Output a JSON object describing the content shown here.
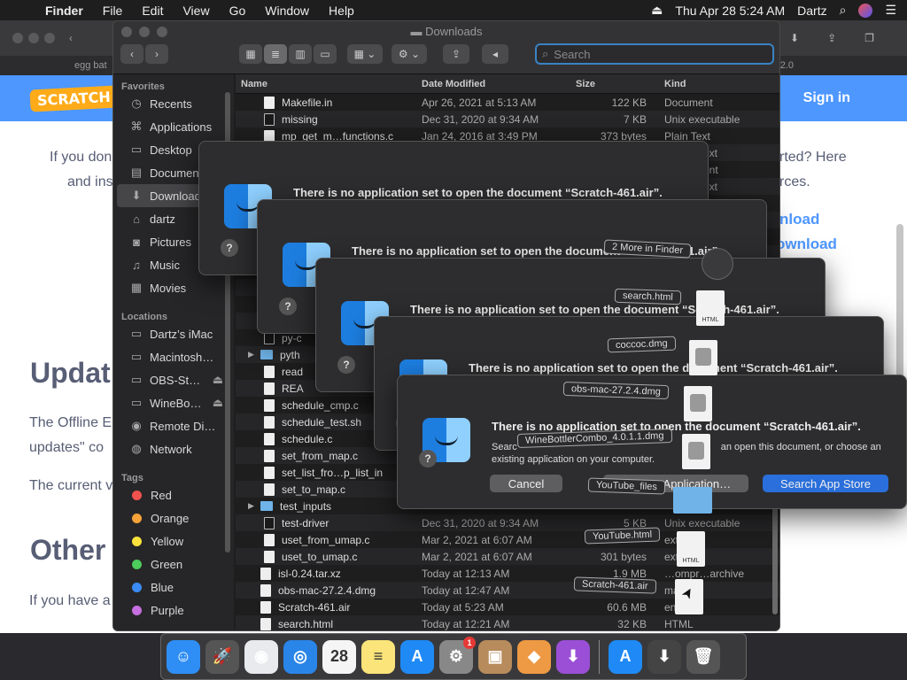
{
  "menubar": {
    "apple": "",
    "app": "Finder",
    "items": [
      "File",
      "Edit",
      "View",
      "Go",
      "Window",
      "Help"
    ],
    "clock": "Thu Apr 28  5:24 AM",
    "user": "Dartz"
  },
  "browser": {
    "tab_fragment": "egg bat",
    "tab_right_fragment": "2.0",
    "logo": "SCRATCH",
    "sign_in": "Sign in",
    "para1_left": "If you don",
    "para1_right": "rted? Here",
    "para2_left": "and ins",
    "para2_right": "rces.",
    "link1": "nload",
    "link2": "ownload",
    "h_update": "Updat",
    "offline_left": "The Offline E",
    "offline2": "updates\" co",
    "current": "The current v",
    "h_other": "Other",
    "ifyou": "If you have a"
  },
  "finder": {
    "title": "Downloads",
    "search_placeholder": "Search",
    "sidebar": {
      "favorites_header": "Favorites",
      "favorites": [
        {
          "label": "Recents",
          "icon": "clock-icon",
          "glyph": "◷"
        },
        {
          "label": "Applications",
          "icon": "applications-icon",
          "glyph": "⌘"
        },
        {
          "label": "Desktop",
          "icon": "desktop-icon",
          "glyph": "▭"
        },
        {
          "label": "Documents",
          "icon": "documents-icon",
          "glyph": "▤"
        },
        {
          "label": "Downloads",
          "icon": "downloads-icon",
          "glyph": "⬇"
        },
        {
          "label": "dartz",
          "icon": "home-icon",
          "glyph": "⌂"
        },
        {
          "label": "Pictures",
          "icon": "camera-icon",
          "glyph": "◙"
        },
        {
          "label": "Music",
          "icon": "music-icon",
          "glyph": "♫"
        },
        {
          "label": "Movies",
          "icon": "movies-icon",
          "glyph": "▦"
        }
      ],
      "locations_header": "Locations",
      "locations": [
        {
          "label": "Dartz’s iMac",
          "icon": "imac-icon",
          "glyph": "▭"
        },
        {
          "label": "Macintosh…",
          "icon": "disk-icon",
          "glyph": "▭"
        },
        {
          "label": "OBS-St…",
          "icon": "disk-icon",
          "glyph": "▭"
        },
        {
          "label": "WineBo…",
          "icon": "disk-icon",
          "glyph": "▭"
        },
        {
          "label": "Remote Di…",
          "icon": "remote-disc-icon",
          "glyph": "◉"
        },
        {
          "label": "Network",
          "icon": "network-icon",
          "glyph": "◍"
        }
      ],
      "tags_header": "Tags",
      "tags": [
        {
          "label": "Red",
          "color": "#f0524f"
        },
        {
          "label": "Orange",
          "color": "#f6a338"
        },
        {
          "label": "Yellow",
          "color": "#f9e23c"
        },
        {
          "label": "Green",
          "color": "#4ccd5c"
        },
        {
          "label": "Blue",
          "color": "#3b8af6"
        },
        {
          "label": "Purple",
          "color": "#c66fe0"
        }
      ]
    },
    "columns": {
      "name": "Name",
      "date": "Date Modified",
      "size": "Size",
      "kind": "Kind"
    },
    "rows_top": [
      {
        "name": "Makefile.in",
        "date": "Apr 26, 2021 at 5:13 AM",
        "size": "122 KB",
        "kind": "Document",
        "type": "doc"
      },
      {
        "name": "missing",
        "date": "Dec 31, 2020 at 9:34 AM",
        "size": "7 KB",
        "kind": "Unix executable",
        "type": "exec"
      },
      {
        "name": "mp_get_m…functions.c",
        "date": "Jan 24, 2016 at 3:49 PM",
        "size": "373 bytes",
        "kind": "Plain Text",
        "type": "doc"
      }
    ],
    "peek_kinds": [
      "ext",
      "ent",
      "ext"
    ],
    "rows_mid": [
      {
        "name": "py-c",
        "indent": 1,
        "type": "exec"
      },
      {
        "name": "pyth",
        "indent": 0,
        "type": "folder",
        "tri": "▶"
      },
      {
        "name": "read",
        "indent": 1,
        "type": "doc"
      },
      {
        "name": "REA",
        "indent": 1,
        "type": "doc"
      },
      {
        "name": "schedule_cmp.c",
        "indent": 1,
        "type": "doc"
      },
      {
        "name": "schedule_test.sh",
        "indent": 1,
        "type": "doc"
      },
      {
        "name": "schedule.c",
        "indent": 1,
        "type": "doc"
      },
      {
        "name": "set_from_map.c",
        "indent": 1,
        "type": "doc"
      },
      {
        "name": "set_list_fro…p_list_in",
        "indent": 1,
        "type": "doc"
      },
      {
        "name": "set_to_map.c",
        "indent": 1,
        "type": "doc"
      },
      {
        "name": "test_inputs",
        "indent": 0,
        "type": "folder",
        "tri": "▶"
      }
    ],
    "rows_bottom": [
      {
        "name": "test-driver",
        "date": "Dec 31, 2020 at 9:34 AM",
        "size": "5 KB",
        "kind": "Unix executable",
        "type": "exec",
        "indent": 1
      },
      {
        "name": "uset_from_umap.c",
        "date": "Mar 2, 2021 at 6:07 AM",
        "size": "",
        "kind": "ext",
        "type": "doc",
        "indent": 1
      },
      {
        "name": "uset_to_umap.c",
        "date": "Mar 2, 2021 at 6:07 AM",
        "size": "301 bytes",
        "kind": "ext",
        "type": "doc",
        "indent": 1
      },
      {
        "name": "isl-0.24.tar.xz",
        "date": "Today at 12:13 AM",
        "size": "1.9 MB",
        "kind": "…ompr…archive",
        "type": "doc",
        "indent": 0
      },
      {
        "name": "obs-mac-27.2.4.dmg",
        "date": "Today at 12:47 AM",
        "size": "",
        "kind": "mage",
        "type": "doc",
        "indent": 0
      },
      {
        "name": "Scratch-461.air",
        "date": "Today at 5:23 AM",
        "size": "60.6 MB",
        "kind": "ent",
        "type": "doc",
        "indent": 0
      },
      {
        "name": "search.html",
        "date": "Today at 12:21 AM",
        "size": "32 KB",
        "kind": "HTML",
        "type": "doc",
        "indent": 0
      }
    ]
  },
  "dialog": {
    "message": "There is no application set to open the document “Scratch-461.air”.",
    "sub_line1": "Searc",
    "sub_line1_right": "an open this document, or choose an",
    "sub_line2": "existing application on your computer.",
    "help": "?",
    "cancel": "Cancel",
    "choose": "Choose Application…",
    "store": "Search App Store"
  },
  "drag": {
    "more": "2 More in Finder",
    "files": [
      "search.html",
      "coccoc.dmg",
      "obs-mac-27.2.4.dmg",
      "WineBottlerCombo_4.0.1.1.dmg",
      "YouTube_files",
      "YouTube.html",
      "Scratch-461.air"
    ],
    "html_tag": "HTML"
  },
  "dock": {
    "items": [
      {
        "name": "finder-icon",
        "bg": "#2f8ef5",
        "glyph": "☺"
      },
      {
        "name": "launchpad-icon",
        "bg": "#555",
        "glyph": "🚀"
      },
      {
        "name": "chrome-icon",
        "bg": "#e8eaed",
        "glyph": "◉"
      },
      {
        "name": "safari-icon",
        "bg": "#2a85e8",
        "glyph": "◎"
      },
      {
        "name": "calendar-icon",
        "bg": "#f5f5f5",
        "glyph": "28"
      },
      {
        "name": "notes-icon",
        "bg": "#fbe47a",
        "glyph": "≡"
      },
      {
        "name": "app-store-icon",
        "bg": "#1f8af5",
        "glyph": "A"
      },
      {
        "name": "system-preferences-icon",
        "bg": "#888",
        "glyph": "⚙",
        "badge": "1"
      },
      {
        "name": "archive-utility-icon",
        "bg": "#b78b5b",
        "glyph": "▣"
      },
      {
        "name": "prism-icon",
        "bg": "#e94",
        "glyph": "◆"
      },
      {
        "name": "installer-icon",
        "bg": "#9a4fd6",
        "glyph": "⬇"
      }
    ],
    "right_items": [
      {
        "name": "app-store-folder-icon",
        "bg": "#1f8af5",
        "glyph": "A"
      },
      {
        "name": "downloads-stack-icon",
        "bg": "#444",
        "glyph": "⬇"
      },
      {
        "name": "trash-icon",
        "bg": "#555",
        "glyph": "🗑"
      }
    ]
  }
}
